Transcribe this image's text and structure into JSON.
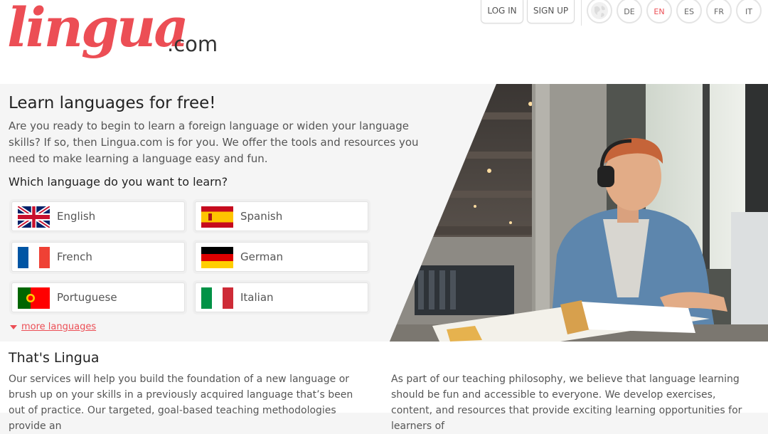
{
  "header": {
    "logo_text": "lingua",
    "logo_suffix": ".com",
    "login_label": "LOG IN",
    "signup_label": "SIGN UP",
    "site_languages": [
      {
        "code": "DE",
        "active": false
      },
      {
        "code": "EN",
        "active": true
      },
      {
        "code": "ES",
        "active": false
      },
      {
        "code": "FR",
        "active": false
      },
      {
        "code": "IT",
        "active": false
      }
    ]
  },
  "hero": {
    "title": "Learn languages for free!",
    "intro": "Are you ready to begin to learn a foreign language or widen your language skills? If so, then Lingua.com is for you. We offer the tools and resources you need to make learning a language easy and fun.",
    "question": "Which language do you want to learn?",
    "languages": [
      {
        "name": "English",
        "flag": "uk-flag-icon"
      },
      {
        "name": "Spanish",
        "flag": "spain-flag-icon"
      },
      {
        "name": "French",
        "flag": "france-flag-icon"
      },
      {
        "name": "German",
        "flag": "germany-flag-icon"
      },
      {
        "name": "Portuguese",
        "flag": "portugal-flag-icon"
      },
      {
        "name": "Italian",
        "flag": "italy-flag-icon"
      }
    ],
    "more_label": "more languages"
  },
  "about": {
    "title": "That's Lingua",
    "left_text": "Our services will help you build the foundation of a new language or brush up on your skills in a previously acquired language that’s been out of practice. Our targeted, goal-based teaching methodologies provide an",
    "right_text": "As part of our teaching philosophy, we believe that language learning should be fun and accessible to everyone. We develop exercises, content, and resources that provide exciting learning opportunities for learners of"
  },
  "colors": {
    "brand": "#ec4e55",
    "text": "#555555",
    "heading": "#222222",
    "background": "#f5f5f5"
  }
}
